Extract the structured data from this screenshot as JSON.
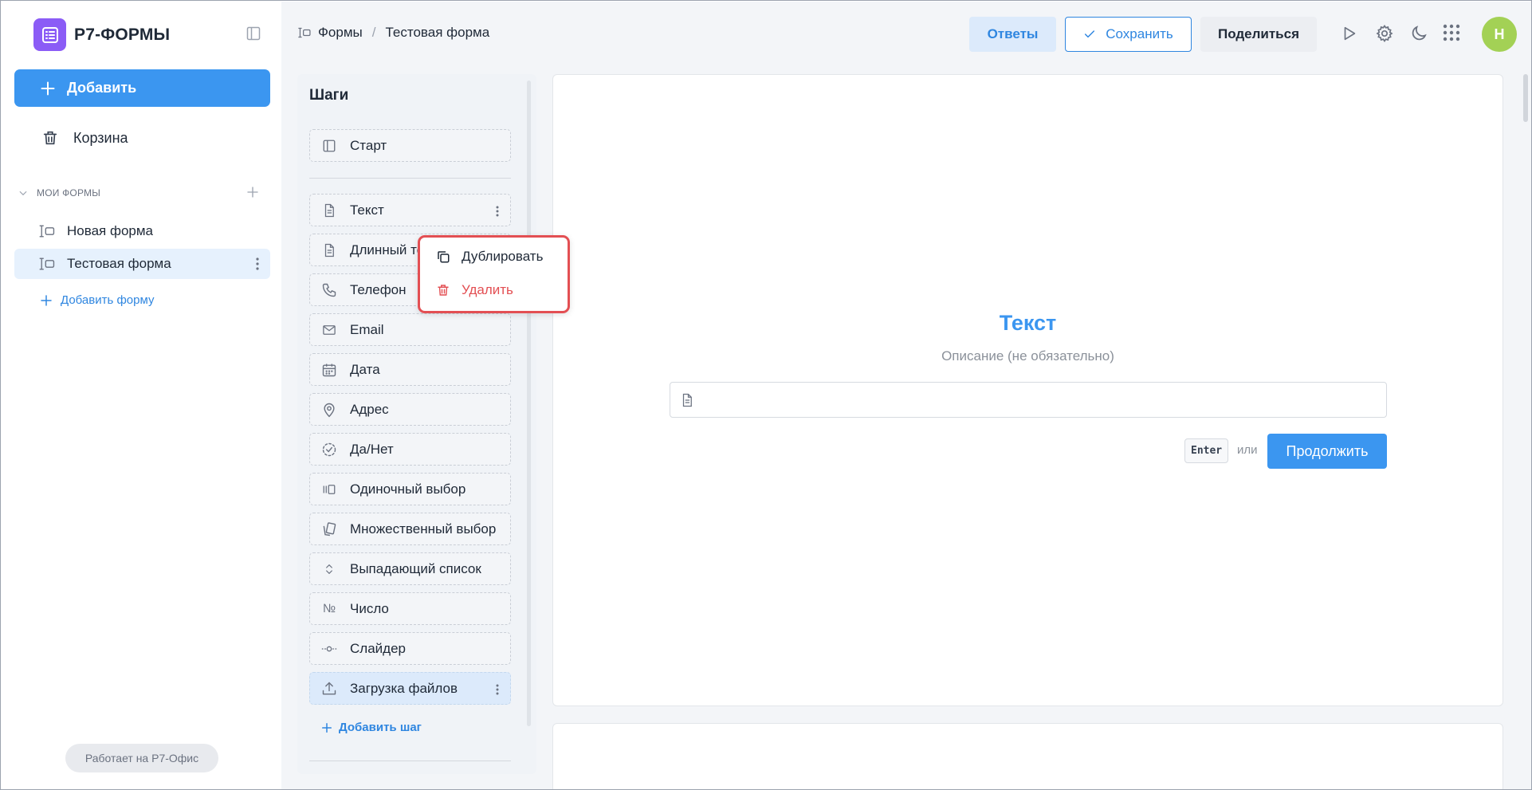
{
  "app": {
    "name": "Р7-ФОРМЫ",
    "powered_by": "Работает на Р7-Офис"
  },
  "sidebar": {
    "add_label": "Добавить",
    "trash_label": "Корзина",
    "section_label": "МОИ ФОРМЫ",
    "forms": [
      {
        "label": "Новая форма",
        "active": false
      },
      {
        "label": "Тестовая форма",
        "active": true
      }
    ],
    "add_form_label": "Добавить форму"
  },
  "header": {
    "breadcrumb": [
      "Формы",
      "Тестовая форма"
    ],
    "answers_label": "Ответы",
    "save_label": "Сохранить",
    "share_label": "Поделиться",
    "avatar_initial": "Н"
  },
  "steps": {
    "title": "Шаги",
    "start_label": "Старт",
    "items": [
      {
        "label": "Текст",
        "icon": "document-icon"
      },
      {
        "label": "Длинный текст",
        "icon": "document-icon"
      },
      {
        "label": "Телефон",
        "icon": "phone-icon"
      },
      {
        "label": "Email",
        "icon": "mail-icon"
      },
      {
        "label": "Дата",
        "icon": "calendar-icon"
      },
      {
        "label": "Адрес",
        "icon": "map-pin-icon"
      },
      {
        "label": "Да/Нет",
        "icon": "dashed-check-icon"
      },
      {
        "label": "Одиночный выбор",
        "icon": "single-choice-icon"
      },
      {
        "label": "Множественный выбор",
        "icon": "multi-choice-icon"
      },
      {
        "label": "Выпадающий список",
        "icon": "chevron-updown-icon"
      },
      {
        "label": "Число",
        "icon": "number-sign-icon"
      },
      {
        "label": "Слайдер",
        "icon": "slider-icon"
      },
      {
        "label": "Загрузка файлов",
        "icon": "upload-icon"
      }
    ],
    "add_step_label": "Добавить шаг"
  },
  "context_menu": {
    "duplicate_label": "Дублировать",
    "delete_label": "Удалить"
  },
  "preview": {
    "title": "Текст",
    "description": "Описание (не обязательно)",
    "input_value": "",
    "kbd_hint": "Enter",
    "or_text": "или",
    "continue_label": "Продолжить"
  },
  "colors": {
    "brand": "#8b5cf6",
    "primary": "#3b96f0",
    "danger": "#e34f53",
    "avatar": "#a3d155"
  }
}
